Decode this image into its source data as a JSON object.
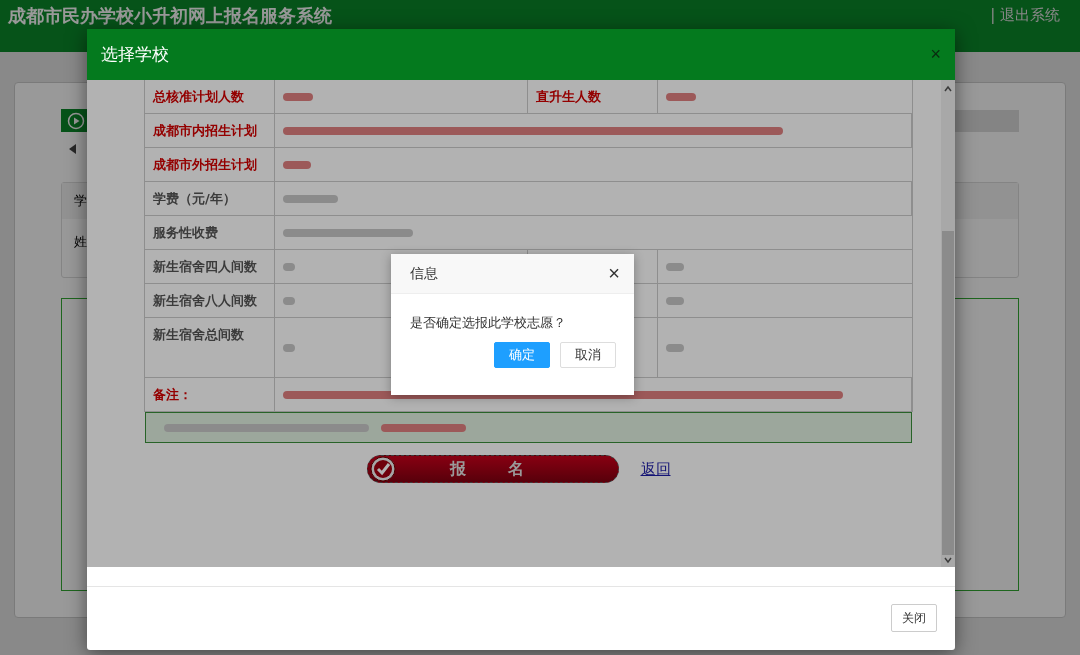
{
  "page": {
    "title": "成都市民办学校小升初网上报名服务系统",
    "logout": "| 退出系统",
    "table_header": "学",
    "table_cell": "姓"
  },
  "modal": {
    "title": "选择学校",
    "close": "×",
    "rows": [
      {
        "kind": "pair",
        "emphasis": true,
        "label": "总核准计划人数",
        "redacted": true,
        "label_2": "直升生人数",
        "redacted_2": true
      },
      {
        "kind": "span",
        "emphasis": true,
        "label": "成都市内招生计划",
        "redacted": true
      },
      {
        "kind": "span",
        "emphasis": true,
        "label": "成都市外招生计划",
        "redacted": true
      },
      {
        "kind": "span",
        "emphasis": false,
        "label": "学费（元/年）",
        "redacted": true
      },
      {
        "kind": "span",
        "emphasis": false,
        "label": "服务性收费",
        "redacted": true
      },
      {
        "kind": "pair",
        "emphasis": false,
        "label": "新生宿舍四人间数",
        "redacted": true,
        "redacted_2": true
      },
      {
        "kind": "pair",
        "emphasis": false,
        "label": "新生宿舍八人间数",
        "redacted": true,
        "redacted_2": true
      },
      {
        "kind": "tall",
        "emphasis": false,
        "label": "新生宿舍总间数",
        "redacted": true,
        "redacted_2": true
      },
      {
        "kind": "span",
        "emphasis": true,
        "label": "备注：",
        "redacted": true
      }
    ],
    "notice": {
      "redacted": true
    },
    "signup": "报名",
    "back": "返回",
    "footer_button": "关闭"
  },
  "dialog": {
    "title": "信息",
    "close": "×",
    "message": "是否确定选报此学校志愿？",
    "buttons": [
      {
        "label": "确定",
        "primary": true
      },
      {
        "label": "取消",
        "primary": false
      }
    ]
  }
}
